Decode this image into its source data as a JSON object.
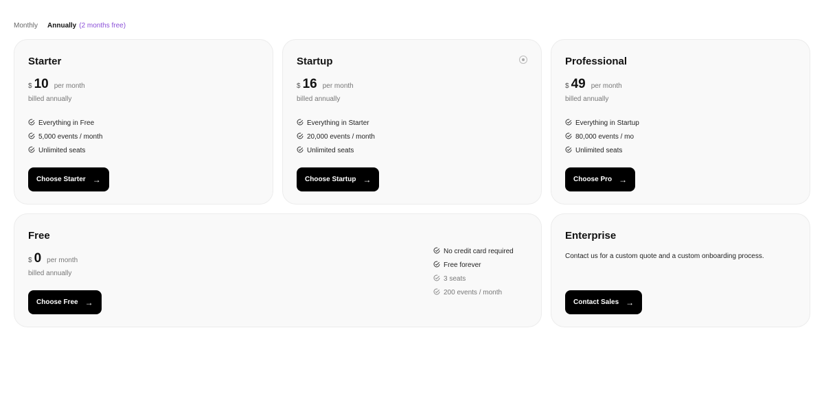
{
  "billing_toggle": {
    "monthly_label": "Monthly",
    "annually_label": "Annually",
    "annually_badge": "(2 months free)",
    "selected": "Annually"
  },
  "plans": {
    "starter": {
      "name": "Starter",
      "currency": "$",
      "price": "10",
      "per": "per month",
      "billed": "billed annually",
      "features": [
        "Everything in Free",
        "5,000 events / month",
        "Unlimited seats"
      ],
      "button": "Choose Starter"
    },
    "startup": {
      "name": "Startup",
      "currency": "$",
      "price": "16",
      "per": "per month",
      "billed": "billed annually",
      "features": [
        "Everything in Starter",
        "20,000 events / month",
        "Unlimited seats"
      ],
      "button": "Choose Startup"
    },
    "professional": {
      "name": "Professional",
      "currency": "$",
      "price": "49",
      "per": "per month",
      "billed": "billed annually",
      "features": [
        "Everything in Startup",
        "80,000 events / mo",
        "Unlimited seats"
      ],
      "button": "Choose Pro"
    },
    "free": {
      "name": "Free",
      "currency": "$",
      "price": "0",
      "per": "per month",
      "billed": "billed annually",
      "features": [
        "No credit card required",
        "Free forever",
        "3 seats",
        "200 events / month"
      ],
      "button": "Choose Free"
    },
    "enterprise": {
      "name": "Enterprise",
      "description": "Contact us for a custom quote and a custom onboarding process.",
      "button": "Contact Sales"
    }
  },
  "icons": {
    "feature": "check-circle-icon",
    "button_arrow": "arrow-right-icon",
    "startup_badge": "target-icon"
  },
  "colors": {
    "accent": "#8b4fd8",
    "button_bg": "#000000",
    "card_bg": "#f9f9f9"
  }
}
